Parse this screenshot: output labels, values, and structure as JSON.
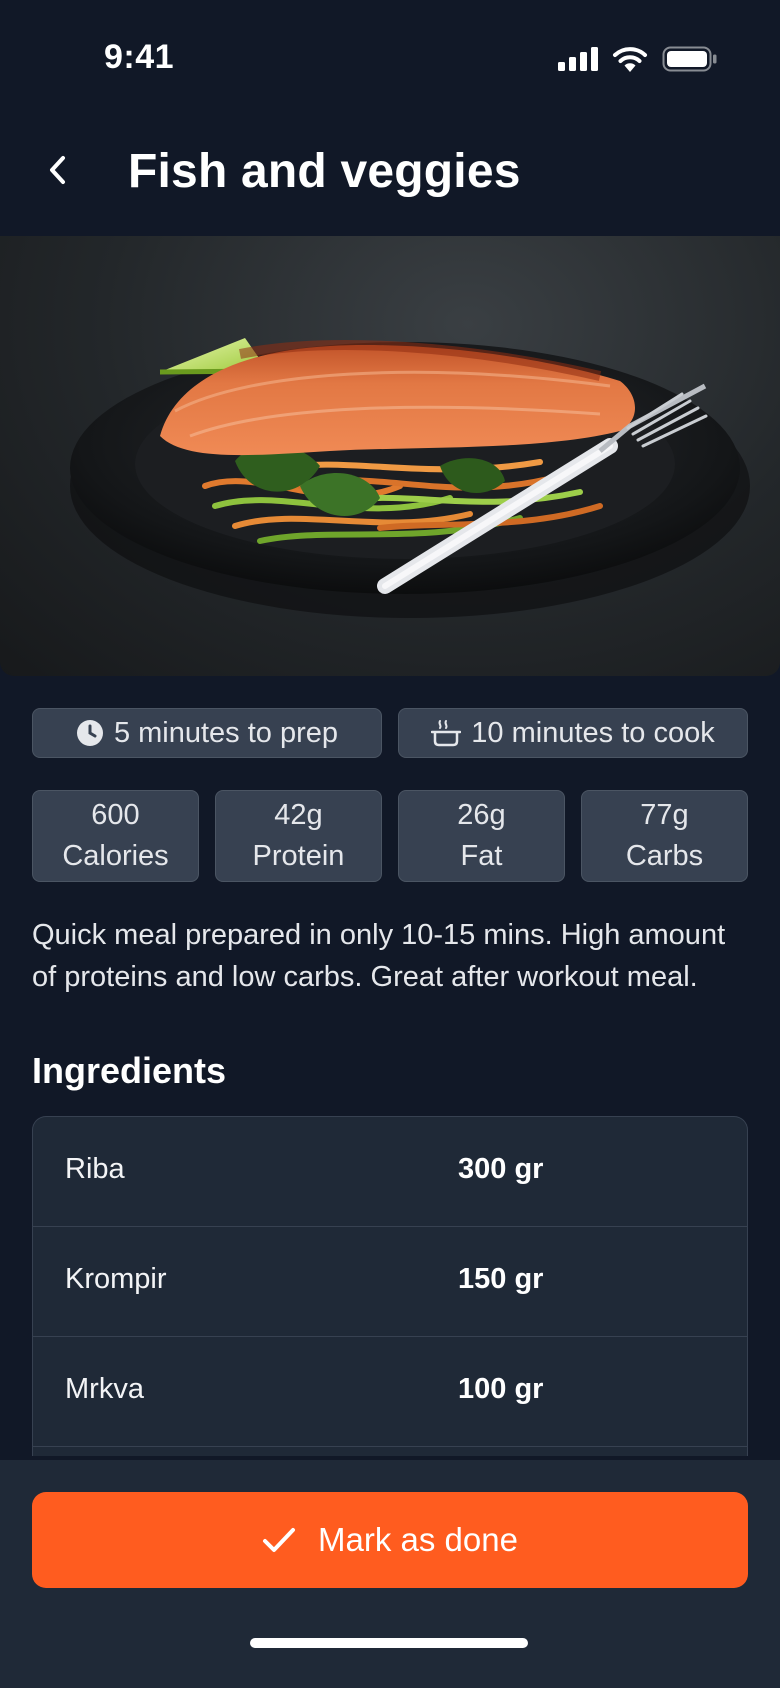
{
  "status_bar": {
    "time": "9:41"
  },
  "header": {
    "title": "Fish and veggies"
  },
  "hero_image": {
    "alt": "Salmon with vegetables"
  },
  "timing": {
    "prep": "5 minutes to prep",
    "cook": "10 minutes to cook"
  },
  "macros": [
    {
      "value": "600",
      "label": "Calories"
    },
    {
      "value": "42g",
      "label": "Protein"
    },
    {
      "value": "26g",
      "label": "Fat"
    },
    {
      "value": "77g",
      "label": "Carbs"
    }
  ],
  "description": "Quick meal prepared in only 10-15 mins. High amount of proteins and low carbs. Great after workout meal.",
  "ingredients": {
    "title": "Ingredients",
    "items": [
      {
        "name": "Riba",
        "qty": "300 gr"
      },
      {
        "name": "Krompir",
        "qty": "150 gr"
      },
      {
        "name": "Mrkva",
        "qty": "100 gr"
      }
    ]
  },
  "action": {
    "label": "Mark as done"
  },
  "colors": {
    "background": "#111827",
    "surface": "#1f2937",
    "chip": "#374151",
    "accent": "#ff5c1f"
  }
}
